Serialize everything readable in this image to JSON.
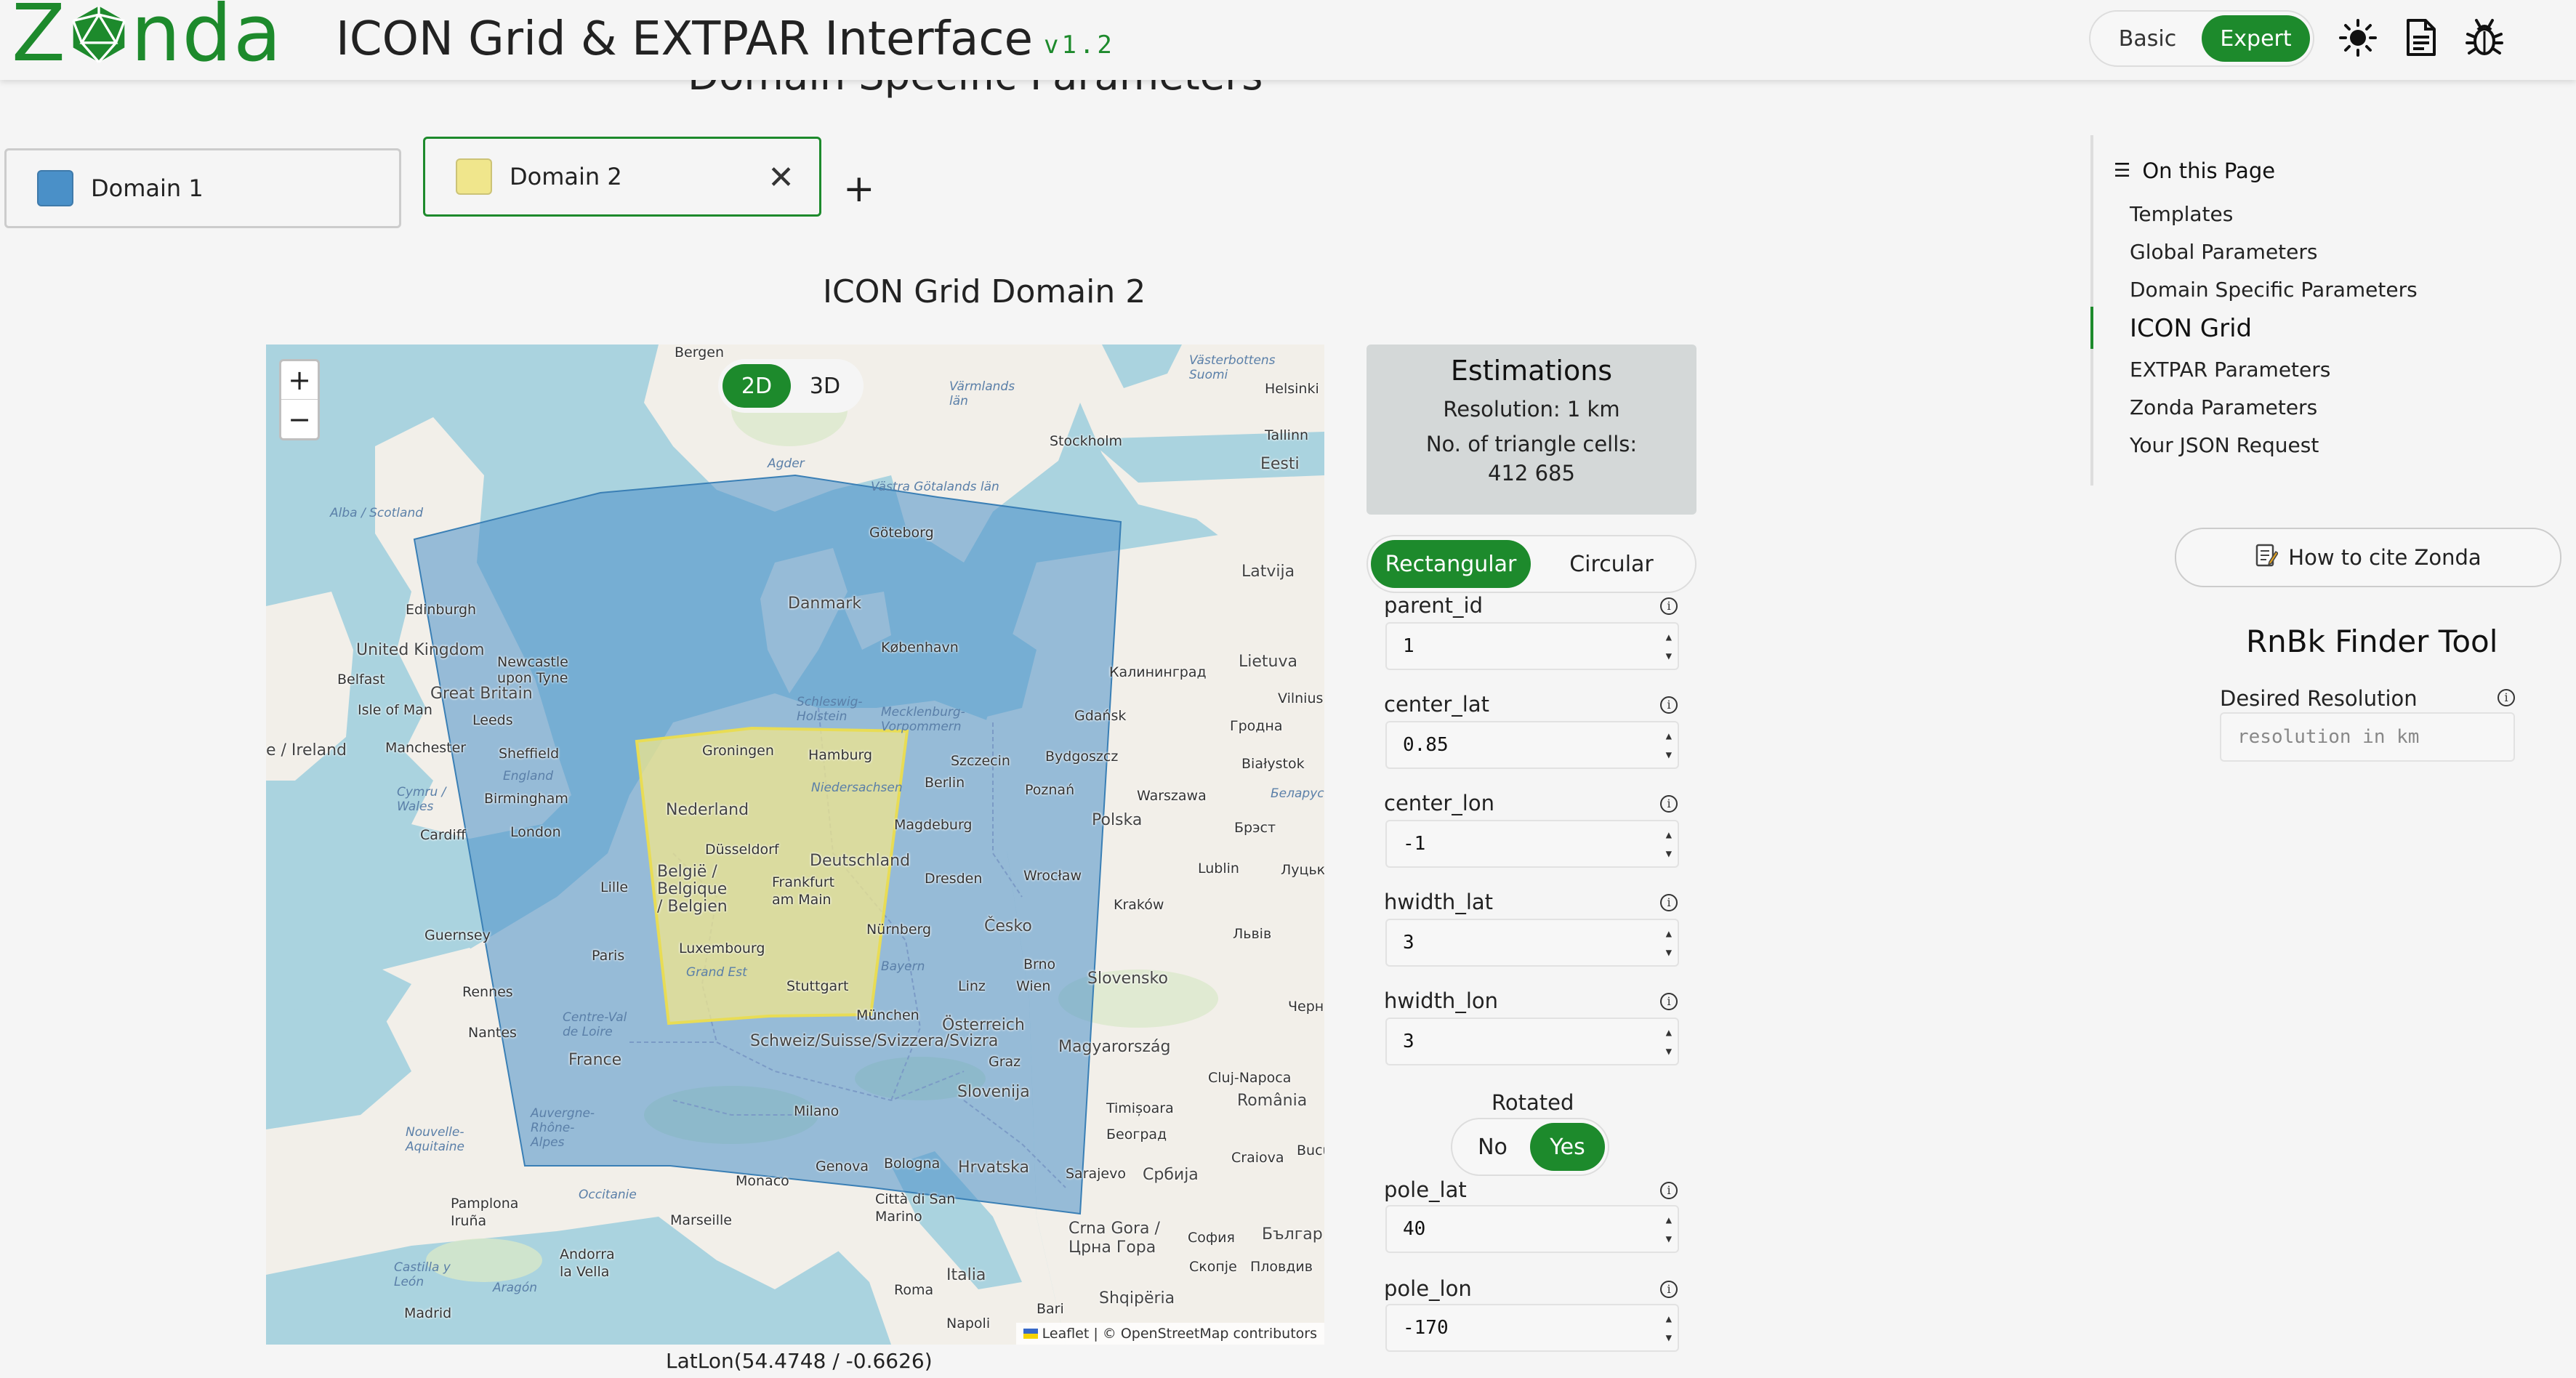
{
  "header": {
    "logo_prefix": "Z",
    "logo_suffix": "nda",
    "title": "ICON Grid & EXTPAR Interface",
    "version": "v1.2",
    "mode_basic": "Basic",
    "mode_expert": "Expert",
    "active_mode": "Expert",
    "icons": [
      "sun-icon",
      "document-icon",
      "bug-icon"
    ]
  },
  "section_heading": "Domain Specific Parameters",
  "domain_tabs": [
    {
      "label": "Domain 1",
      "color": "#4a90c8"
    },
    {
      "label": "Domain 2",
      "color": "#f0e68c",
      "active": true
    }
  ],
  "add_tab_label": "+",
  "close_tab_label": "✕",
  "grid_title": "ICON Grid Domain 2",
  "map": {
    "zoom_in": "+",
    "zoom_out": "−",
    "view_2d": "2D",
    "view_3d": "3D",
    "active_view": "2D",
    "attribution": "Leaflet | © OpenStreetMap contributors",
    "latlon": "LatLon(54.4748 / -0.6626)",
    "domain1_color": "#4a90c8",
    "domain2_color": "#f0e68c",
    "labels": {
      "bergen": "Bergen",
      "varmlands": "Värmlands län",
      "vasternorr": "Västerbottens Suomi",
      "helsinki": "Helsinki",
      "stockholm": "Stockholm",
      "tallinn": "Tallinn",
      "eesti": "Eesti",
      "agder": "Agder",
      "vastra": "Västra Götalands län",
      "alba": "Alba / Scotland",
      "goteborg": "Göteborg",
      "latvija": "Latvija",
      "edinburgh": "Edinburgh",
      "danmark": "Danmark",
      "kobenhavn": "København",
      "uk": "United Kingdom",
      "newcastle": "Newcastle upon Tyne",
      "belfast": "Belfast",
      "greatbritain": "Great Britain",
      "isleofman": "Isle of Man",
      "leeds": "Leeds",
      "schleswig": "Schleswig-Holstein",
      "mecklenburg": "Mecklenburg-Vorpommern",
      "kaliningrad": "Калининград",
      "lietuva": "Lietuva",
      "vilnius": "Vilnius",
      "gdansk": "Gdańsk",
      "ireland": "e / Ireland",
      "manchester": "Manchester",
      "sheffield": "Sheffield",
      "groningen": "Groningen",
      "hamburg": "Hamburg",
      "szczecin": "Szczecin",
      "bydgoszcz": "Bydgoszcz",
      "grodno": "Гродна",
      "england": "England",
      "birmingham": "Birmingham",
      "niedersachsen": "Niedersachsen",
      "berlin": "Berlin",
      "poznan": "Poznań",
      "warszawa": "Warszawa",
      "bialystok": "Białystok",
      "cymru": "Cymru / Wales",
      "nederland": "Nederland",
      "magdeburg": "Magdeburg",
      "polska": "Polska",
      "belarus": "Беларусь",
      "cardiff": "Cardiff",
      "london": "London",
      "dusseldorf": "Düsseldorf",
      "deutschland": "Deutschland",
      "brest": "Брэст",
      "lublin": "Lublin",
      "lutsk": "Луцьк",
      "lille": "Lille",
      "belgie": "België / Belgique / Belgien",
      "frankfurt": "Frankfurt am Main",
      "dresden": "Dresden",
      "wroclaw": "Wrocław",
      "krakow": "Kraków",
      "guernsey": "Guernsey",
      "paris": "Paris",
      "luxembourg": "Luxembourg",
      "nurnberg": "Nürnberg",
      "cesko": "Česko",
      "lviv": "Львів",
      "grandest": "Grand Est",
      "bayern": "Bayern",
      "brno": "Brno",
      "rennes": "Rennes",
      "stuttgart": "Stuttgart",
      "linz": "Linz",
      "wien": "Wien",
      "slovensko": "Slovensko",
      "chern": "Черн",
      "nantes": "Nantes",
      "centre": "Centre-Val de Loire",
      "munchen": "München",
      "osterreich": "Österreich",
      "schweiz": "Schweiz/Suisse/Svizzera/Svizra",
      "magyar": "Magyarország",
      "france": "France",
      "graz": "Graz",
      "cluj": "Cluj-Napoca",
      "romania": "România",
      "slovenija": "Slovenija",
      "timisoara": "Timișoara",
      "nouvelle": "Nouvelle-Aquitaine",
      "auvergne": "Auvergne-Rhône-Alpes",
      "milano": "Milano",
      "beograd": "Београд",
      "craiova": "Craiova",
      "bucu": "Bucu",
      "occitanie": "Occitanie",
      "monaco": "Monaco",
      "genova": "Genova",
      "bologna": "Bologna",
      "hrvatska": "Hrvatska",
      "sarajevo": "Sarajevo",
      "srbija": "Србија",
      "pamplona": "Pamplona Iruña",
      "marseille": "Marseille",
      "sanmarino": "Città di San Marino",
      "crnagora": "Crna Gora / Црна Гора",
      "sofia": "София",
      "bulgaria": "Българ",
      "castilla": "Castilla y León",
      "andorra": "Andorra la Vella",
      "aragon": "Aragón",
      "italia": "Italia",
      "roma": "Roma",
      "skopje": "Скопје",
      "plovdiv": "Пловдив",
      "madrid": "Madrid",
      "bari": "Bari",
      "napoli": "Napoli",
      "shqiperia": "Shqipëria"
    }
  },
  "estimations": {
    "title": "Estimations",
    "resolution": "Resolution: 1 km",
    "cells_label": "No. of triangle cells:",
    "cells_value": "412 685"
  },
  "shape": {
    "rectangular": "Rectangular",
    "circular": "Circular",
    "active": "Rectangular"
  },
  "params": {
    "parent_id": {
      "label": "parent_id",
      "value": "1"
    },
    "center_lat": {
      "label": "center_lat",
      "value": "0.85"
    },
    "center_lon": {
      "label": "center_lon",
      "value": "-1"
    },
    "hwidth_lat": {
      "label": "hwidth_lat",
      "value": "3"
    },
    "hwidth_lon": {
      "label": "hwidth_lon",
      "value": "3"
    },
    "pole_lat": {
      "label": "pole_lat",
      "value": "40"
    },
    "pole_lon": {
      "label": "pole_lon",
      "value": "-170"
    }
  },
  "rotated": {
    "label": "Rotated",
    "no": "No",
    "yes": "Yes",
    "active": "Yes"
  },
  "toc": {
    "title": "On this Page",
    "items": [
      "Templates",
      "Global Parameters",
      "Domain Specific Parameters",
      "ICON Grid",
      "EXTPAR Parameters",
      "Zonda Parameters",
      "Your JSON Request"
    ],
    "active": "ICON Grid"
  },
  "cite_button": "How to cite Zonda",
  "rnbk": {
    "title": "RnBk Finder Tool",
    "res_label": "Desired Resolution",
    "res_placeholder": "resolution in km"
  },
  "info_glyph": "i"
}
